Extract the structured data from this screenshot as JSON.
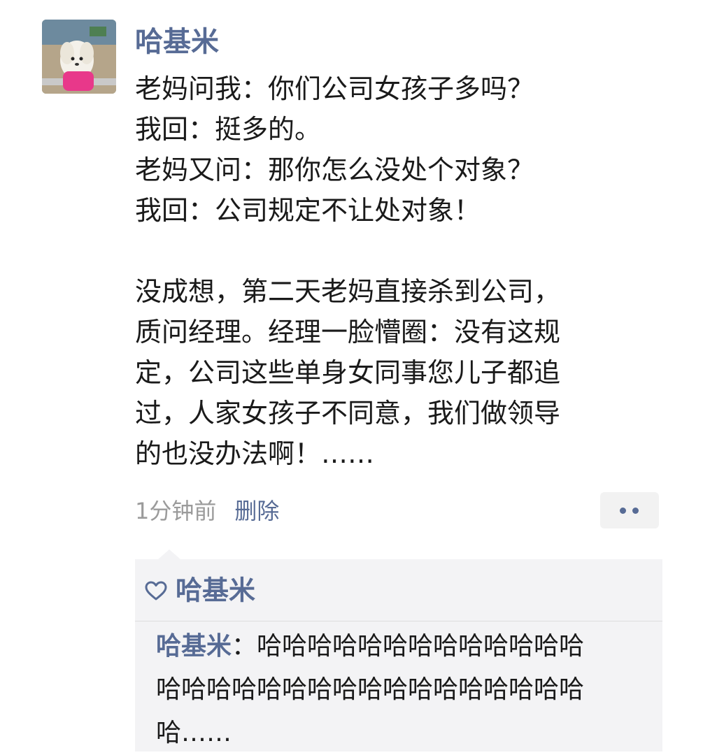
{
  "post": {
    "username": "哈基米",
    "lines": [
      "老妈问我：你们公司女孩子多吗？",
      "我回：挺多的。",
      "老妈又问：那你怎么没处个对象？",
      "我回：公司规定不让处对象！",
      "",
      "没成想，第二天老妈直接杀到公司，",
      "质问经理。经理一脸懵圈：没有这规",
      "定，公司这些单身女同事您儿子都追",
      "过，人家女孩子不同意，我们做领导",
      "的也没办法啊！……"
    ],
    "time": "1分钟前",
    "delete_label": "删除"
  },
  "likes": {
    "names": "哈基米"
  },
  "comment": {
    "author": "哈基米",
    "separator": "：",
    "lines": [
      "哈哈哈哈哈哈哈哈哈哈哈哈哈",
      "哈哈哈哈哈哈哈哈哈哈哈哈哈哈哈哈哈",
      "哈……"
    ]
  },
  "colors": {
    "link": "#576b95",
    "text": "#1a1a1a",
    "muted": "#9b9b9b",
    "comment_bg": "#f3f3f5"
  },
  "icons": {
    "more": "more-dots-icon",
    "like": "heart-icon"
  }
}
